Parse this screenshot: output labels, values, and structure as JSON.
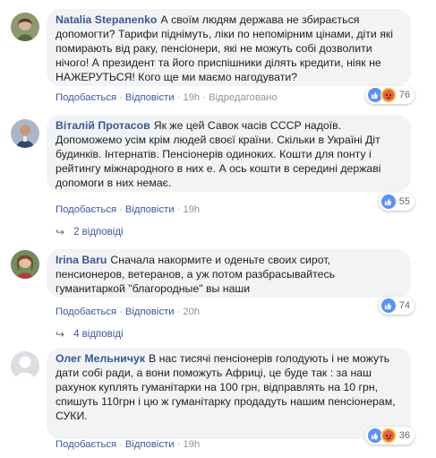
{
  "comments": [
    {
      "author": "Natalia Stepanenko",
      "text": "А своїм людям держава не збирається допомогти? Тарифи піднімуть, ліки по непомірним цінами, діти які помирають від раку, пенсіонери, які не можуть собі дозволити нічого! А президент та його приспішники ділять кредити, ніяк не НАЖЕРУТЬСЯ! Кого ще ми маємо нагодувати?",
      "like_label": "Подобається",
      "reply_label": "Відповісти",
      "time": "19h",
      "edited_label": "Відредаговано",
      "reaction_count": "76",
      "reactions": [
        "like-icon",
        "angry-icon"
      ]
    },
    {
      "author": "Віталій Протасов",
      "text": "Як же цей Савок часів СССР надоїв. Допоможемо усім крім людей своєї країни. Скільки в Україні Діт будинків. Інтернатів. Пенсіонерів одиноких. Кошти для понту і рейтингу міжнародного в них е. А ось кошти в середині державі допомоги в них немає.",
      "like_label": "Подобається",
      "reply_label": "Відповісти",
      "time": "19h",
      "reaction_count": "55",
      "reactions": [
        "like-icon"
      ],
      "replies_label": "2 відповіді"
    },
    {
      "author": "Irina Baru",
      "text": "Сначала накормите и оденьте своих сирот, пенсионеров, ветеранов, а уж потом разбрасывайтесь гуманитаркой \"благородные\" вы наши",
      "like_label": "Подобається",
      "reply_label": "Відповісти",
      "time": "20h",
      "reaction_count": "74",
      "reactions": [
        "like-icon"
      ],
      "replies_label": "4 відповіді"
    },
    {
      "author": "Олег Мельничук",
      "text": "В нас тисячі пенсіонерів голодують і не можуть дати собі ради, а вони поможуть Африці, це буде так : за наш рахунок куплять гуманітарки на 100 грн, відправлять на 10 грн, спишуть 110грн і цю ж гуманітарку продадуть нашим пенсіонерам, СУКИ.",
      "like_label": "Подобається",
      "reply_label": "Відповісти",
      "time": "19h",
      "reaction_count": "36",
      "reactions": [
        "like-icon",
        "angry-icon"
      ]
    }
  ],
  "colors": {
    "link": "#385898",
    "bubble": "#f2f3f5",
    "muted": "#90949c",
    "like": "#5890ff",
    "angry": "#f7b125"
  }
}
